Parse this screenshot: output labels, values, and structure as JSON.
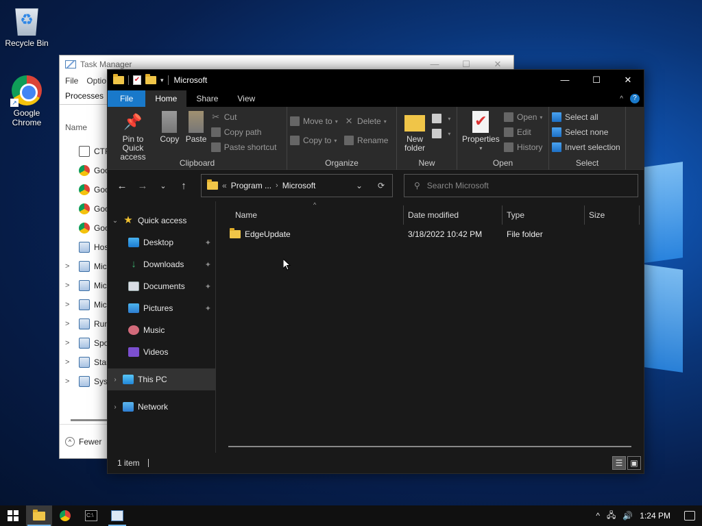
{
  "desktop": {
    "icons": [
      {
        "label": "Recycle Bin"
      },
      {
        "label": "Google Chrome"
      }
    ]
  },
  "task_manager": {
    "title": "Task Manager",
    "menu": [
      "File",
      "Optio"
    ],
    "tab": "Processes",
    "col_name": "Name",
    "rows": [
      {
        "label": "CTF",
        "icon": "ctf-loader-icon",
        "expand": ""
      },
      {
        "label": "Goo",
        "icon": "chrome-icon",
        "expand": ""
      },
      {
        "label": "Goo",
        "icon": "chrome-icon",
        "expand": ""
      },
      {
        "label": "Goo",
        "icon": "chrome-icon",
        "expand": ""
      },
      {
        "label": "Goo",
        "icon": "chrome-icon",
        "expand": ""
      },
      {
        "label": "Hos",
        "icon": "window-icon",
        "expand": ""
      },
      {
        "label": "Mic",
        "icon": "window-icon",
        "expand": ">"
      },
      {
        "label": "Mic",
        "icon": "window-icon",
        "expand": ">"
      },
      {
        "label": "Mic",
        "icon": "user-icon",
        "expand": ">"
      },
      {
        "label": "Run",
        "icon": "window-icon",
        "expand": ">"
      },
      {
        "label": "Spo",
        "icon": "printer-icon",
        "expand": ">"
      },
      {
        "label": "Star",
        "icon": "window-icon",
        "expand": ">"
      },
      {
        "label": "Syst",
        "icon": "window-icon",
        "expand": ">"
      }
    ],
    "footer": "Fewer"
  },
  "explorer": {
    "title": "Microsoft",
    "tabs": {
      "file": "File",
      "home": "Home",
      "share": "Share",
      "view": "View"
    },
    "ribbon": {
      "clipboard": {
        "pin": "Pin to Quick access",
        "copy": "Copy",
        "paste": "Paste",
        "cut": "Cut",
        "copy_path": "Copy path",
        "paste_shortcut": "Paste shortcut",
        "label": "Clipboard"
      },
      "organize": {
        "move_to": "Move to",
        "copy_to": "Copy to",
        "delete": "Delete",
        "rename": "Rename",
        "label": "Organize"
      },
      "new": {
        "new_folder": "New folder",
        "label": "New"
      },
      "open": {
        "properties": "Properties",
        "open": "Open",
        "edit": "Edit",
        "history": "History",
        "label": "Open"
      },
      "select": {
        "select_all": "Select all",
        "select_none": "Select none",
        "invert": "Invert selection",
        "label": "Select"
      }
    },
    "address": {
      "prefix": "«",
      "segment1": "Program ...",
      "segment2": "Microsoft"
    },
    "search_placeholder": "Search Microsoft",
    "nav": {
      "quick_access": "Quick access",
      "desktop": "Desktop",
      "downloads": "Downloads",
      "documents": "Documents",
      "pictures": "Pictures",
      "music": "Music",
      "videos": "Videos",
      "this_pc": "This PC",
      "network": "Network"
    },
    "columns": {
      "name": "Name",
      "date": "Date modified",
      "type": "Type",
      "size": "Size"
    },
    "files": [
      {
        "name": "EdgeUpdate",
        "date": "3/18/2022 10:42 PM",
        "type": "File folder",
        "size": ""
      }
    ],
    "status": "1 item"
  },
  "taskbar": {
    "clock": "1:24 PM",
    "apps": [
      "file-explorer",
      "chrome",
      "command-prompt",
      "task-manager"
    ]
  },
  "colors": {
    "file_tab": "#1979ca",
    "explorer_bg": "#191919",
    "ribbon_bg": "#2b2b2b",
    "folder": "#f0c548"
  }
}
